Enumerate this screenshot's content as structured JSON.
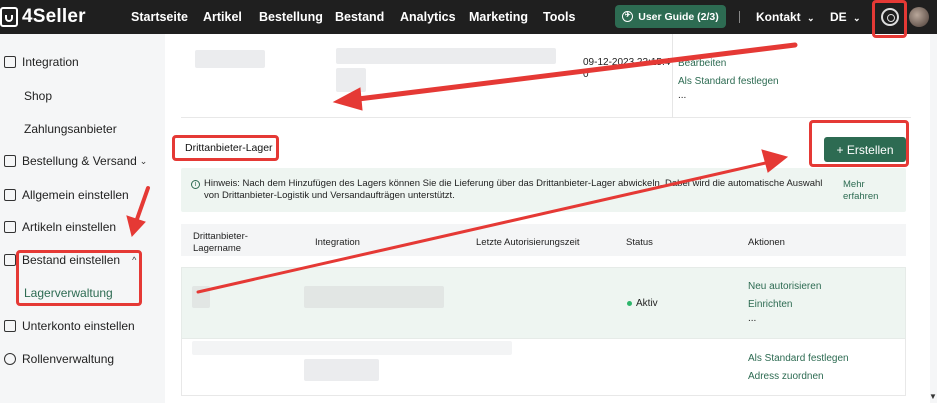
{
  "topbar": {
    "logo": "4Seller",
    "nav": [
      "Startseite",
      "Artikel",
      "Bestellung",
      "Bestand",
      "Analytics",
      "Marketing",
      "Tools"
    ],
    "user_guide": "User Guide (2/3)",
    "contact": "Kontakt",
    "language": "DE",
    "icons": {
      "settings": "gear-icon",
      "avatar": "avatar",
      "guide": "compass-icon"
    }
  },
  "sidebar": {
    "items": [
      {
        "label": "Integration",
        "icon": "integration-icon"
      },
      {
        "label": "Shop",
        "sub": true
      },
      {
        "label": "Zahlungsanbieter",
        "sub": true
      },
      {
        "label": "Bestellung & Versand",
        "icon": "order-icon",
        "chevron": "down"
      },
      {
        "label": "Allgemein einstellen",
        "icon": "settings-doc-icon"
      },
      {
        "label": "Artikeln einstellen",
        "icon": "article-icon"
      },
      {
        "label": "Bestand einstellen",
        "icon": "stock-icon",
        "chevron": "up"
      },
      {
        "label": "Lagerverwaltung",
        "sub": true,
        "active": true
      },
      {
        "label": "Unterkonto einstellen",
        "icon": "subaccount-icon"
      },
      {
        "label": "Rollenverwaltung",
        "icon": "role-icon"
      }
    ]
  },
  "top_row": {
    "date": "09-12-2023 23:15:4",
    "date_line2": "0",
    "actions": [
      "Bearbeiten",
      "Als Standard festlegen",
      "..."
    ]
  },
  "section": {
    "title": "Drittanbieter-Lager",
    "create_button": "+ Erstellen"
  },
  "hint": {
    "text": "Hinweis: Nach dem Hinzufügen des Lagers können Sie die Lieferung über das Drittanbieter-Lager abwickeln. Dabei wird die automatische Auswahl von Drittanbieter-Logistik und Versandaufträgen unterstützt.",
    "link": "Mehr erfahren"
  },
  "table": {
    "headers": [
      "Drittanbieter-Lagername",
      "Integration",
      "Letzte Autorisierungszeit",
      "Status",
      "Aktionen"
    ],
    "row": {
      "status": "Aktiv",
      "actions": [
        "Neu autorisieren",
        "Einrichten",
        "...",
        "Als Standard festlegen",
        "Adress zuordnen"
      ]
    }
  },
  "colors": {
    "accent": "#2d6b52",
    "annotation": "#e53935",
    "topbar": "#1f1f1f"
  }
}
